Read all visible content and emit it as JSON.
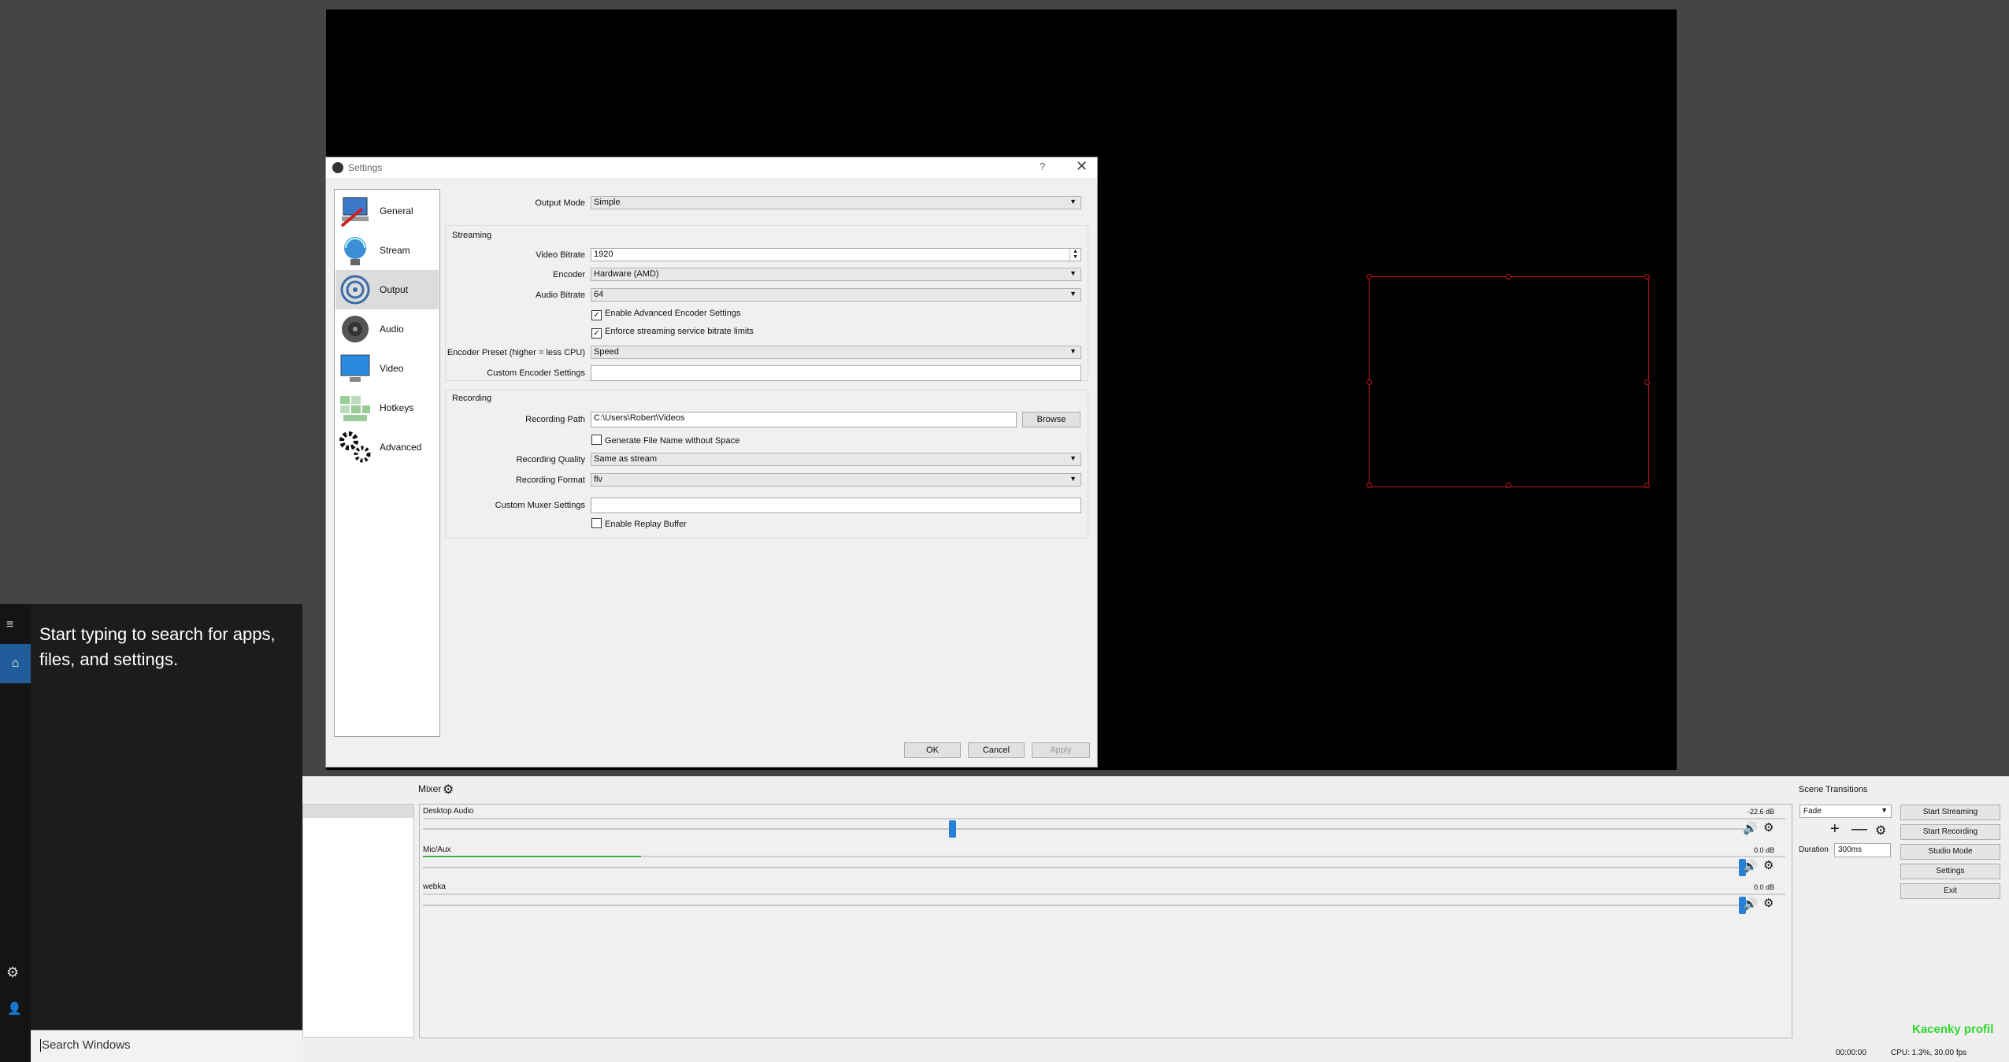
{
  "settings_dialog": {
    "title": "Settings",
    "help": "?",
    "close": "✕",
    "nav": [
      {
        "label": "General",
        "icon": "general-icon"
      },
      {
        "label": "Stream",
        "icon": "stream-icon"
      },
      {
        "label": "Output",
        "icon": "output-icon"
      },
      {
        "label": "Audio",
        "icon": "audio-icon"
      },
      {
        "label": "Video",
        "icon": "video-icon"
      },
      {
        "label": "Hotkeys",
        "icon": "hotkeys-icon"
      },
      {
        "label": "Advanced",
        "icon": "advanced-icon"
      }
    ],
    "selected_nav": "Output",
    "output_mode_label": "Output Mode",
    "output_mode_value": "Simple",
    "streaming": {
      "group_title": "Streaming",
      "video_bitrate_label": "Video Bitrate",
      "video_bitrate_value": "1920",
      "encoder_label": "Encoder",
      "encoder_value": "Hardware (AMD)",
      "audio_bitrate_label": "Audio Bitrate",
      "audio_bitrate_value": "64",
      "enable_advanced_label": "Enable Advanced Encoder Settings",
      "enable_advanced_checked": true,
      "enforce_limits_label": "Enforce streaming service bitrate limits",
      "enforce_limits_checked": true,
      "preset_label": "Encoder Preset (higher = less CPU)",
      "preset_value": "Speed",
      "custom_encoder_label": "Custom Encoder Settings",
      "custom_encoder_value": ""
    },
    "recording": {
      "group_title": "Recording",
      "path_label": "Recording Path",
      "path_value": "C:\\Users\\Robert\\Videos",
      "browse_label": "Browse",
      "gen_filename_label": "Generate File Name without Space",
      "gen_filename_checked": false,
      "quality_label": "Recording Quality",
      "quality_value": "Same as stream",
      "format_label": "Recording Format",
      "format_value": "flv",
      "custom_muxer_label": "Custom Muxer Settings",
      "custom_muxer_value": "",
      "replay_buffer_label": "Enable Replay Buffer",
      "replay_buffer_checked": false
    },
    "buttons": {
      "ok": "OK",
      "cancel": "Cancel",
      "apply": "Apply"
    }
  },
  "mixer": {
    "title": "Mixer",
    "channels": [
      {
        "name": "Desktop Audio",
        "db": "-22.6 dB",
        "level": 0.0,
        "volume": 0.4
      },
      {
        "name": "Mic/Aux",
        "db": "0.0 dB",
        "level": 0.16,
        "volume": 1.0
      },
      {
        "name": "webka",
        "db": "0.0 dB",
        "level": 0.0,
        "volume": 1.0
      }
    ]
  },
  "transitions": {
    "title": "Scene Transitions",
    "selected": "Fade",
    "duration_label": "Duration",
    "duration_value": "300ms"
  },
  "controls": {
    "start_streaming": "Start Streaming",
    "start_recording": "Start Recording",
    "studio_mode": "Studio Mode",
    "settings": "Settings",
    "exit": "Exit"
  },
  "overlay_text": "Kacenky profil",
  "status": {
    "time": "00:00:00",
    "cpu": "CPU: 1.3%, 30.00 fps"
  },
  "start_menu": {
    "prompt": "Start typing to search for apps, files, and settings.",
    "search_placeholder": "Search Windows"
  },
  "colors": {
    "accent": "#2680d8",
    "selection": "#c4141d",
    "overlay_green": "#2dd62d",
    "start_highlight": "#1f5c99"
  }
}
